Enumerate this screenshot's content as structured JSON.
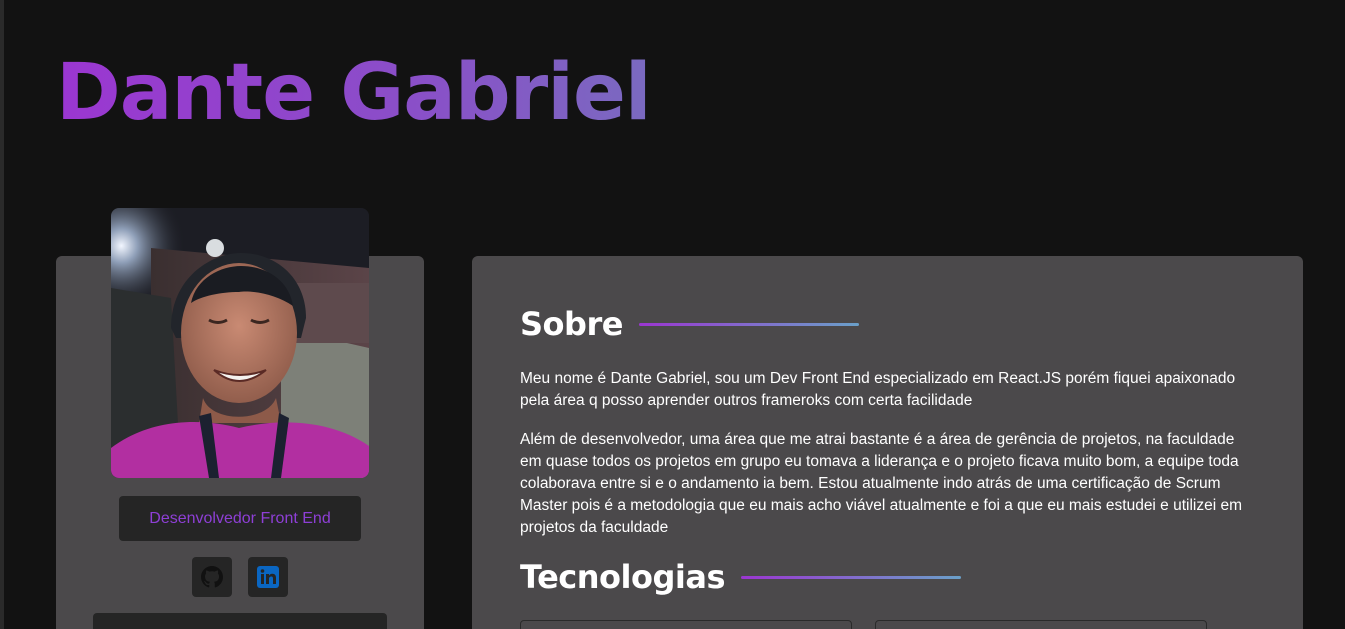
{
  "header": {
    "name": "Dante Gabriel"
  },
  "profile": {
    "avatar_icon": "profile-photo",
    "role": "Desenvolvedor Front End",
    "social": [
      {
        "icon": "github-icon",
        "label": "GitHub"
      },
      {
        "icon": "linkedin-icon",
        "label": "LinkedIn"
      }
    ]
  },
  "about": {
    "heading": "Sobre",
    "paragraphs": [
      "Meu nome é Dante Gabriel, sou um Dev Front End especializado em React.JS porém fiquei apaixonado pela área q posso aprender outros frameroks com certa facilidade",
      "Além de desenvolvedor, uma área que me atrai bastante é a área de gerência de projetos, na faculdade em quase todos os projetos em grupo eu tomava a liderança e o projeto ficava muito bom, a equipe toda colaborava entre si e o andamento ia bem. Estou atualmente indo atrás de uma certificação de Scrum Master pois é a metodologia que eu mais acho viável atualmente e foi a que eu mais estudei e utilizei em projetos da faculdade"
    ]
  },
  "technologies": {
    "heading": "Tecnologias"
  },
  "colors": {
    "accent": "#9b36d1",
    "accent_end": "#6aa0c9",
    "card_bg": "#4b494b",
    "page_bg": "#121212",
    "linkedin": "#0a66c2"
  }
}
